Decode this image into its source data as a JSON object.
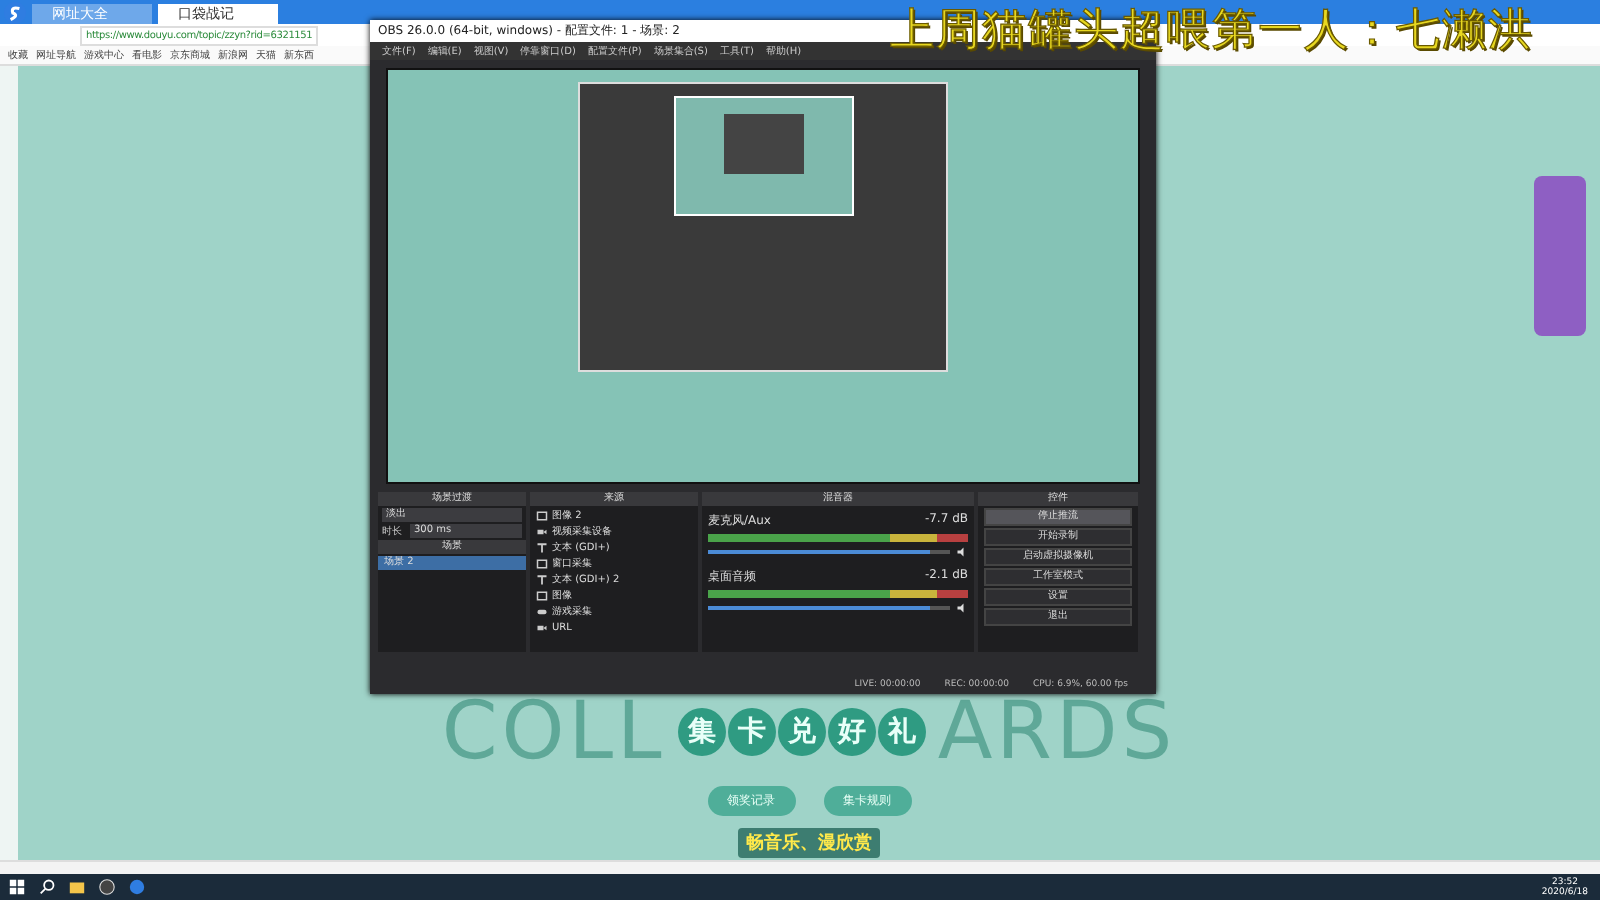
{
  "browser": {
    "tabs": [
      {
        "label": "网址大全",
        "selected": false
      },
      {
        "label": "口袋战记",
        "selected": true
      }
    ],
    "address": "https://www.douyu.com/topic/zzyn?rid=6321151",
    "bookmarks": [
      "收藏",
      "网址导航",
      "游戏中心",
      "看电影",
      "京东商城",
      "新浪网",
      "天猫",
      "新东西"
    ]
  },
  "overlay_title": "上周猫罐头超喂第一人：七濑洪",
  "obs": {
    "title": "OBS 26.0.0 (64-bit, windows) - 配置文件: 1 - 场景: 2",
    "menu": [
      "文件(F)",
      "编辑(E)",
      "视图(V)",
      "停靠窗口(D)",
      "配置文件(P)",
      "场景集合(S)",
      "工具(T)",
      "帮助(H)"
    ],
    "transitions": {
      "title": "场景过渡",
      "value": "淡出",
      "duration_label": "时长",
      "duration": "300 ms"
    },
    "scenes": {
      "title": "场景",
      "items": [
        {
          "label": "场景 2",
          "selected": true
        }
      ]
    },
    "sources": {
      "title": "来源",
      "items": [
        {
          "label": "图像 2",
          "kind": "image"
        },
        {
          "label": "视频采集设备",
          "kind": "camera"
        },
        {
          "label": "文本 (GDI+)",
          "kind": "text"
        },
        {
          "label": "窗口采集",
          "kind": "window"
        },
        {
          "label": "文本 (GDI+) 2",
          "kind": "text"
        },
        {
          "label": "图像",
          "kind": "image"
        },
        {
          "label": "游戏采集",
          "kind": "game"
        },
        {
          "label": "URL",
          "kind": "camera"
        }
      ]
    },
    "mixer": {
      "title": "混音器",
      "channels": [
        {
          "name": "麦克风/Aux",
          "reading": "-7.7 dB",
          "level": 0.92
        },
        {
          "name": "桌面音频",
          "reading": "-2.1 dB",
          "level": 0.92
        }
      ]
    },
    "controls": {
      "title": "控件",
      "buttons": [
        {
          "label": "停止推流",
          "active": true
        },
        {
          "label": "开始录制",
          "active": false
        },
        {
          "label": "启动虚拟摄像机",
          "active": false
        },
        {
          "label": "工作室模式",
          "active": false
        },
        {
          "label": "设置",
          "active": false
        },
        {
          "label": "退出",
          "active": false
        }
      ]
    },
    "status": {
      "live": "LIVE: 00:00:00",
      "rec": "REC: 00:00:00",
      "cpu": "CPU: 6.9%, 60.00 fps"
    }
  },
  "page": {
    "title_chars": [
      "集",
      "卡",
      "兑",
      "好",
      "礼"
    ],
    "bg_left": "COLL",
    "bg_right": "ARDS",
    "buttons": [
      "领奖记录",
      "集卡规则"
    ],
    "subtitle": "畅音乐、漫欣赏"
  },
  "taskbar": {
    "time": "23:52",
    "date": "2020/6/18"
  }
}
